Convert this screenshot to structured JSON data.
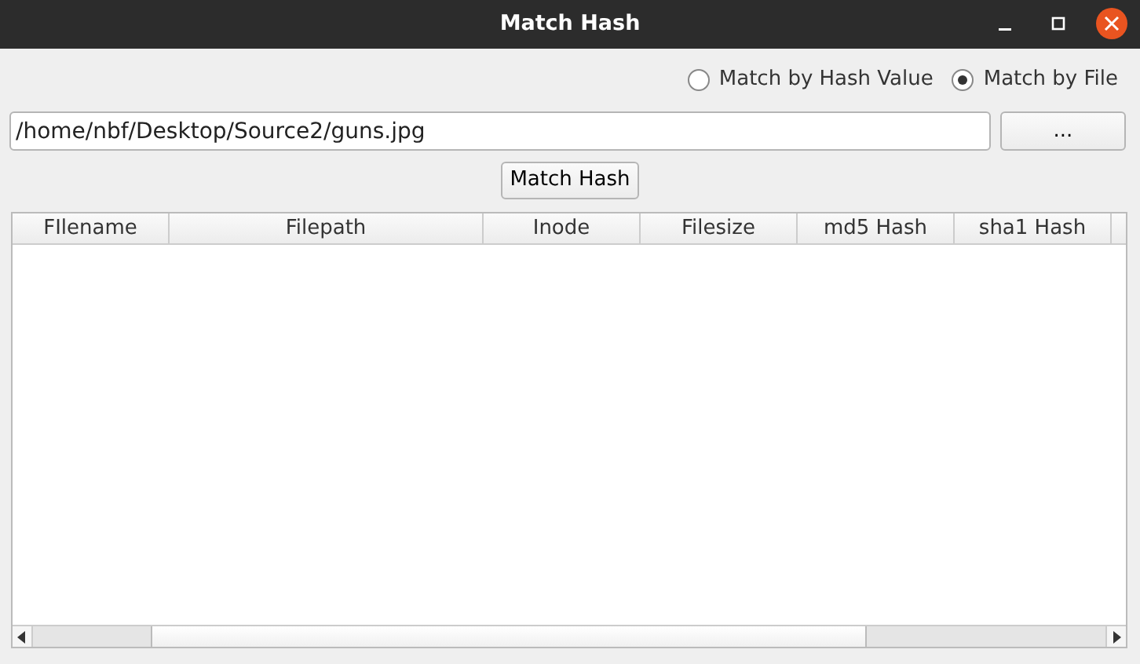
{
  "window": {
    "title": "Match Hash"
  },
  "match_mode": [
    {
      "label": "Match by Hash Value",
      "selected": false
    },
    {
      "label": "Match by File",
      "selected": true
    }
  ],
  "path_field": {
    "value": "/home/nbf/Desktop/Source2/guns.jpg"
  },
  "browse_button": "...",
  "match_button": "Match Hash",
  "table": {
    "columns": [
      "FIlename",
      "Filepath",
      "Inode",
      "Filesize",
      "md5 Hash",
      "sha1 Hash"
    ]
  }
}
